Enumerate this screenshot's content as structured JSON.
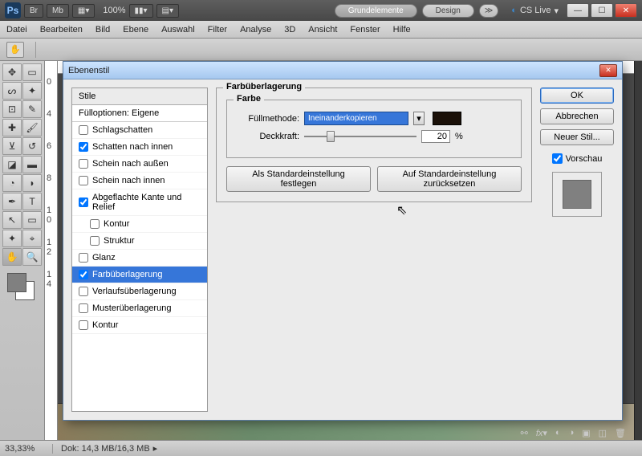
{
  "app": {
    "logo": "Ps"
  },
  "topbar": {
    "br": "Br",
    "mb": "Mb",
    "zoom": "100%",
    "workspaces": [
      "Grundelemente",
      "Design"
    ],
    "cslive": "CS Live"
  },
  "menu": [
    "Datei",
    "Bearbeiten",
    "Bild",
    "Ebene",
    "Auswahl",
    "Filter",
    "Analyse",
    "3D",
    "Ansicht",
    "Fenster",
    "Hilfe"
  ],
  "status": {
    "zoom": "33,33%",
    "dok": "Dok: 14,3 MB/16,3 MB"
  },
  "dialog": {
    "title": "Ebenenstil",
    "styles_header": "Stile",
    "styles_sub": "Fülloptionen: Eigene",
    "items": [
      {
        "label": "Schlagschatten",
        "checked": false
      },
      {
        "label": "Schatten nach innen",
        "checked": true
      },
      {
        "label": "Schein nach außen",
        "checked": false
      },
      {
        "label": "Schein nach innen",
        "checked": false
      },
      {
        "label": "Abgeflachte Kante und Relief",
        "checked": true
      },
      {
        "label": "Kontur",
        "checked": false,
        "indent": true
      },
      {
        "label": "Struktur",
        "checked": false,
        "indent": true
      },
      {
        "label": "Glanz",
        "checked": false
      },
      {
        "label": "Farbüberlagerung",
        "checked": true,
        "selected": true
      },
      {
        "label": "Verlaufsüberlagerung",
        "checked": false
      },
      {
        "label": "Musterüberlagerung",
        "checked": false
      },
      {
        "label": "Kontur",
        "checked": false
      }
    ],
    "group_title": "Farbüberlagerung",
    "color_group": "Farbe",
    "fill_label": "Füllmethode:",
    "fill_value": "Ineinanderkopieren",
    "opacity_label": "Deckkraft:",
    "opacity_value": "20",
    "opacity_unit": "%",
    "btn_default": "Als Standardeinstellung festlegen",
    "btn_reset": "Auf Standardeinstellung zurücksetzen",
    "btn_ok": "OK",
    "btn_cancel": "Abbrechen",
    "btn_new": "Neuer Stil...",
    "preview_label": "Vorschau"
  }
}
